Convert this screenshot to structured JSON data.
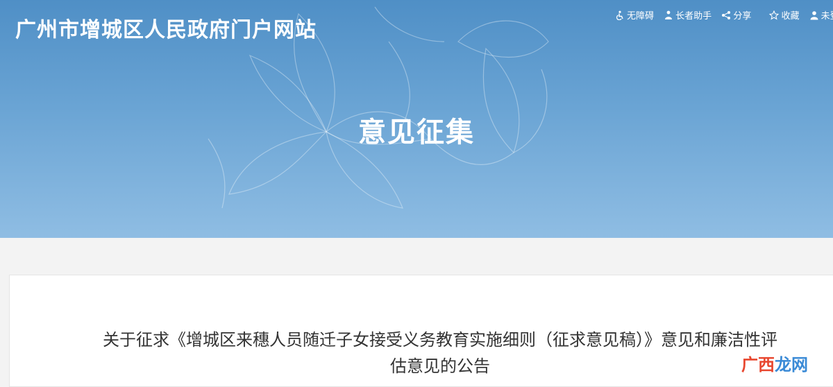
{
  "header": {
    "site_title": "广州市增城区人民政府门户网站",
    "section_title": "意见征集"
  },
  "toolbar": {
    "items": [
      {
        "label": "无障碍",
        "icon": "accessibility-icon"
      },
      {
        "label": "长者助手",
        "icon": "elder-person-icon"
      },
      {
        "label": "分享",
        "icon": "share-icon"
      },
      {
        "label": "收藏",
        "icon": "star-icon"
      },
      {
        "label": "未登",
        "icon": "user-icon"
      }
    ]
  },
  "notice": {
    "title_line1": "关于征求《增城区来穗人员随迁子女接受义务教育实施细则（征求意见稿）》意见和廉洁性评",
    "title_line2": "估意见的公告"
  },
  "watermark": {
    "part1": "广西",
    "part2": "龙网"
  },
  "colors": {
    "banner_top": "#4f8fc6",
    "banner_bottom": "#8fbde3",
    "page_bg": "#f3f3f3",
    "watermark_red": "#e8472f",
    "watermark_blue": "#3a8ad6"
  }
}
